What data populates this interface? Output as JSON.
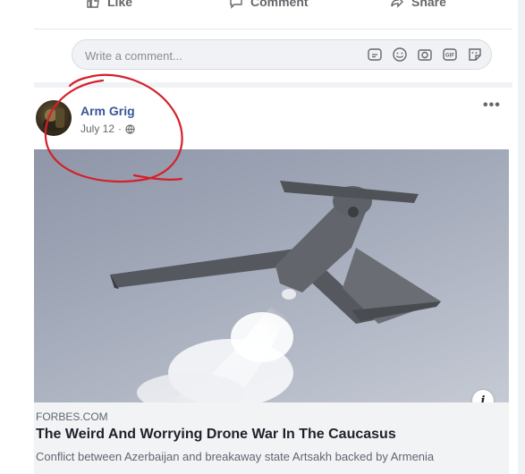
{
  "actions": [
    {
      "label": "Like",
      "icon": "thumbs-up-icon"
    },
    {
      "label": "Comment",
      "icon": "comment-bubble-icon"
    },
    {
      "label": "Share",
      "icon": "share-arrow-icon"
    }
  ],
  "comment": {
    "placeholder": "Write a comment...",
    "icons": [
      "sticker-icon",
      "emoji-icon",
      "camera-icon",
      "gif-icon",
      "sticker-face-icon"
    ]
  },
  "post": {
    "author": "Arm Grig",
    "date": "July 12",
    "privacy_icon": "globe-icon",
    "more_label": "•••"
  },
  "link": {
    "domain": "FORBES.COM",
    "title": "The Weird And Worrying Drone War In The Caucasus",
    "description": "Conflict between Azerbaijan and breakaway state Artsakh backed by Armenia",
    "info_label": "i"
  },
  "colors": {
    "author": "#385898",
    "annotation": "#d4202a",
    "meta_background": "#f2f3f5"
  }
}
